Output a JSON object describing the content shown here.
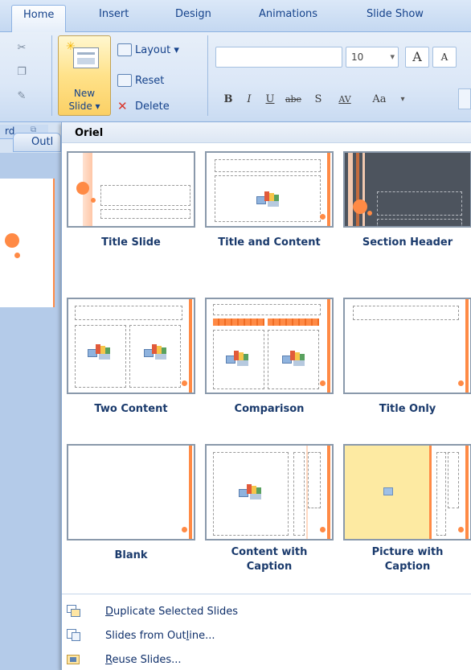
{
  "tabs": [
    {
      "label": "Home",
      "active": true
    },
    {
      "label": "Insert"
    },
    {
      "label": "Design"
    },
    {
      "label": "Animations"
    },
    {
      "label": "Slide Show"
    }
  ],
  "ribbon": {
    "new_slide": {
      "line1": "New",
      "line2": "Slide ▾"
    },
    "layout_label": "Layout ▾",
    "reset_label": "Reset",
    "delete_label": "Delete",
    "font_size": "10",
    "font_size_arrow": "▾",
    "grow_font": "A",
    "shrink_font": "A",
    "bold": "B",
    "italic": "I",
    "underline": "U",
    "strike": "abe",
    "shadow": "S",
    "spacing": "AV",
    "change_case": "Aa",
    "clipboard_group_label": "rd",
    "outline_tab_label": "Outl"
  },
  "gallery": {
    "theme_name": "Oriel",
    "layouts": [
      {
        "label": "Title Slide"
      },
      {
        "label": "Title and Content"
      },
      {
        "label": "Section Header"
      },
      {
        "label": "Two Content"
      },
      {
        "label": "Comparison"
      },
      {
        "label": "Title Only"
      },
      {
        "label": "Blank"
      },
      {
        "label": "Content with\nCaption"
      },
      {
        "label": "Picture with\nCaption"
      }
    ]
  },
  "menu": {
    "items": [
      {
        "pre": "",
        "ul": "D",
        "post": "uplicate Selected Slides"
      },
      {
        "pre": "Slides from Out",
        "ul": "l",
        "post": "ine..."
      },
      {
        "pre": "",
        "ul": "R",
        "post": "euse Slides..."
      }
    ]
  },
  "colors": {
    "ribbon_bg": "#dbe7f7",
    "accent_orange": "#ff8a45",
    "highlight_yellow": "#ffe28a",
    "label_blue": "#15428b"
  }
}
